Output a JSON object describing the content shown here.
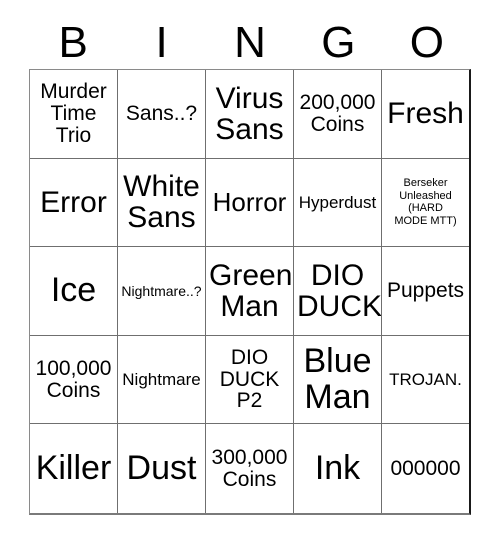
{
  "card": {
    "title": "BINGO",
    "header": {
      "letters": [
        "B",
        "I",
        "N",
        "G",
        "O"
      ]
    },
    "rows": [
      [
        {
          "text": "Murder\nTime\nTrio",
          "size": "md"
        },
        {
          "text": "Sans..?",
          "size": "md"
        },
        {
          "text": "Virus\nSans",
          "size": "xl"
        },
        {
          "text": "200,000\nCoins",
          "size": "md"
        },
        {
          "text": "Fresh",
          "size": "xl"
        }
      ],
      [
        {
          "text": "Error",
          "size": "xl"
        },
        {
          "text": "White\nSans",
          "size": "xl"
        },
        {
          "text": "Horror",
          "size": "lg"
        },
        {
          "text": "Hyperdust",
          "size": "sm"
        },
        {
          "text": "Berseker\nUnleashed\n(HARD\nMODE MTT)",
          "size": "xxs"
        }
      ],
      [
        {
          "text": "Ice",
          "size": "xxl"
        },
        {
          "text": "Nightmare..?",
          "size": "xs"
        },
        {
          "text": "Green\nMan",
          "size": "xl"
        },
        {
          "text": "DIO\nDUCK",
          "size": "xl"
        },
        {
          "text": "Puppets",
          "size": "md"
        }
      ],
      [
        {
          "text": "100,000\nCoins",
          "size": "md"
        },
        {
          "text": "Nightmare",
          "size": "sm"
        },
        {
          "text": "DIO\nDUCK\nP2",
          "size": "md"
        },
        {
          "text": "Blue\nMan",
          "size": "xxl"
        },
        {
          "text": "TROJAN.",
          "size": "sm"
        }
      ],
      [
        {
          "text": "Killer",
          "size": "xxl"
        },
        {
          "text": "Dust",
          "size": "xxl"
        },
        {
          "text": "300,000\nCoins",
          "size": "md"
        },
        {
          "text": "Ink",
          "size": "xxl"
        },
        {
          "text": "000000",
          "size": "md"
        }
      ]
    ]
  },
  "colors": {
    "background": "#ffffff",
    "text": "#000000",
    "grid_line": "#6f6f6f",
    "grid_border": "#1a1a1a"
  }
}
